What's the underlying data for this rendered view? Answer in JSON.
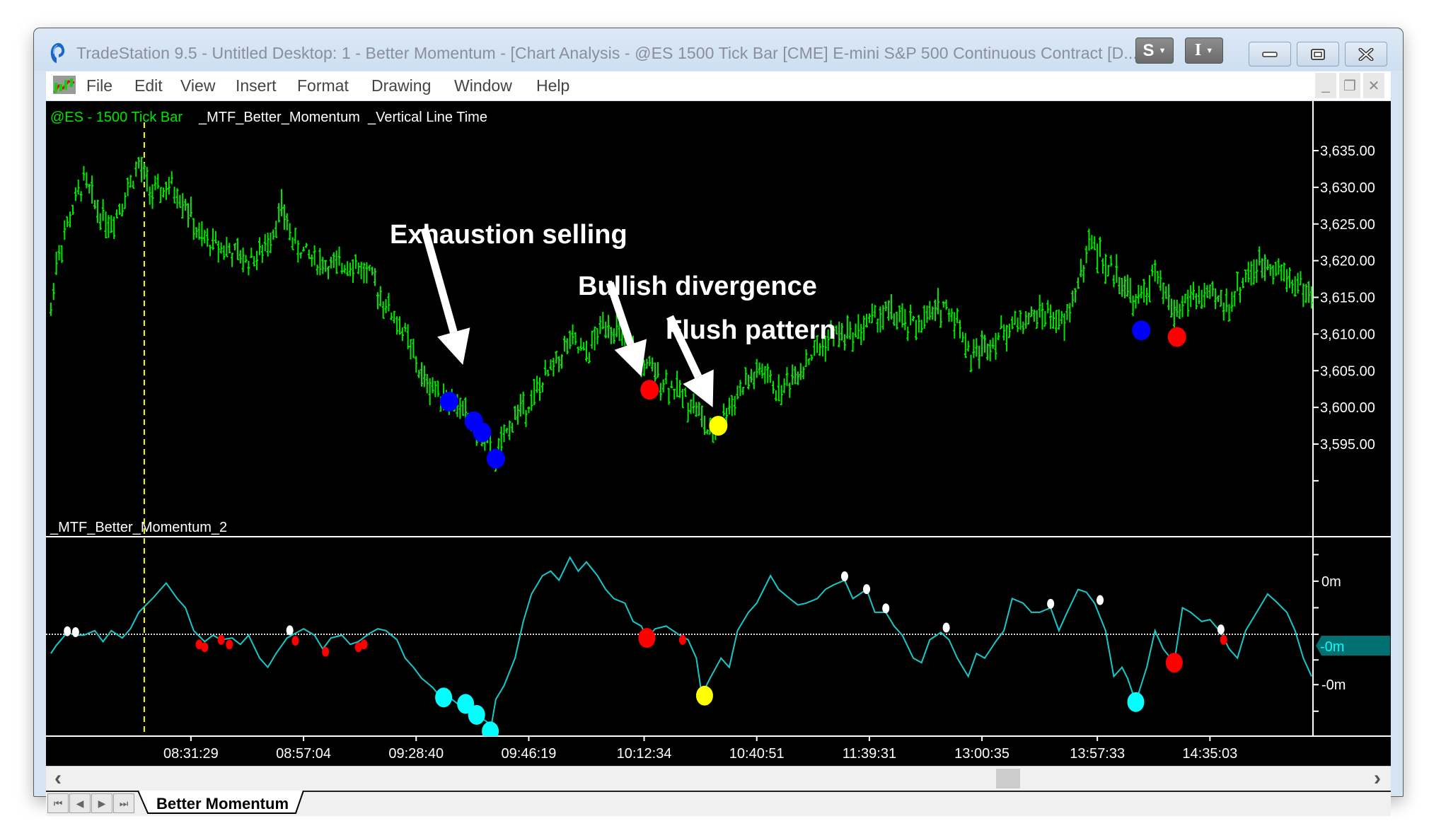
{
  "window": {
    "title": "TradeStation 9.5 - Untitled Desktop: 1 - Better Momentum - [Chart Analysis - @ES 1500 Tick Bar [CME] E-mini S&P 500 Continuous Contract [D...]]",
    "s_button": "S",
    "i_button": "I",
    "controls": {
      "minimize": "minimize",
      "restore": "restore",
      "close": "close"
    }
  },
  "menu": {
    "items": [
      "File",
      "Edit",
      "View",
      "Insert",
      "Format",
      "Drawing",
      "Window",
      "Help"
    ],
    "mdi": {
      "minimize": "_",
      "restore": "❐",
      "close": "✕"
    }
  },
  "chart_data": [
    {
      "type": "ohlc",
      "title_symbol": "@ES - 1500 Tick Bar",
      "title_studies": "_MTF_Better_Momentum  _Vertical Line Time",
      "ylabel": "",
      "ylim": [
        3590,
        3637.5
      ],
      "yticks": [
        "3,635.00",
        "3,630.00",
        "3,625.00",
        "3,620.00",
        "3,615.00",
        "3,610.00",
        "3,605.00",
        "3,600.00",
        "3,595.00"
      ],
      "ytick_values": [
        3635,
        3630,
        3625,
        3620,
        3615,
        3610,
        3605,
        3600,
        3595
      ],
      "bar_count": 461,
      "series_color": "#00e600",
      "price_path": [
        [
          1,
          3613
        ],
        [
          3,
          3620
        ],
        [
          8,
          3626
        ],
        [
          13,
          3631
        ],
        [
          18,
          3627
        ],
        [
          23,
          3625
        ],
        [
          28,
          3629
        ],
        [
          33,
          3633
        ],
        [
          38,
          3629
        ],
        [
          45,
          3630
        ],
        [
          50,
          3628
        ],
        [
          55,
          3623
        ],
        [
          63,
          3622
        ],
        [
          72,
          3620
        ],
        [
          78,
          3621
        ],
        [
          85,
          3627
        ],
        [
          90,
          3622
        ],
        [
          98,
          3620
        ],
        [
          105,
          3619
        ],
        [
          110,
          3620
        ],
        [
          117,
          3618
        ],
        [
          123,
          3614
        ],
        [
          130,
          3610
        ],
        [
          136,
          3604
        ],
        [
          143,
          3602
        ],
        [
          150,
          3600
        ],
        [
          156,
          3597
        ],
        [
          163,
          3593
        ],
        [
          170,
          3599
        ],
        [
          176,
          3601
        ],
        [
          183,
          3605
        ],
        [
          190,
          3609
        ],
        [
          196,
          3607
        ],
        [
          203,
          3612
        ],
        [
          210,
          3609
        ],
        [
          216,
          3606
        ],
        [
          223,
          3604
        ],
        [
          230,
          3602
        ],
        [
          236,
          3600
        ],
        [
          241,
          3596
        ],
        [
          246,
          3599
        ],
        [
          253,
          3603
        ],
        [
          260,
          3605
        ],
        [
          266,
          3602
        ],
        [
          273,
          3605
        ],
        [
          280,
          3608
        ],
        [
          286,
          3610
        ],
        [
          293,
          3610
        ],
        [
          300,
          3612
        ],
        [
          306,
          3613
        ],
        [
          313,
          3611
        ],
        [
          320,
          3612
        ],
        [
          326,
          3614
        ],
        [
          331,
          3612
        ],
        [
          336,
          3607
        ],
        [
          343,
          3609
        ],
        [
          350,
          3611
        ],
        [
          356,
          3612
        ],
        [
          363,
          3613
        ],
        [
          370,
          3611
        ],
        [
          375,
          3617
        ],
        [
          380,
          3623
        ],
        [
          385,
          3619
        ],
        [
          390,
          3618
        ],
        [
          396,
          3614
        ],
        [
          403,
          3618
        ],
        [
          410,
          3613
        ],
        [
          416,
          3615
        ],
        [
          423,
          3615
        ],
        [
          430,
          3614
        ],
        [
          436,
          3618
        ],
        [
          445,
          3620
        ],
        [
          450,
          3618
        ],
        [
          455,
          3617
        ],
        [
          460,
          3615
        ]
      ],
      "markers": [
        {
          "bar": 146,
          "price": 3600.8,
          "color": "#0000ff"
        },
        {
          "bar": 155,
          "price": 3598.1,
          "color": "#0000ff"
        },
        {
          "bar": 158,
          "price": 3596.6,
          "color": "#0000ff"
        },
        {
          "bar": 163,
          "price": 3593.0,
          "color": "#0000ff"
        },
        {
          "bar": 219,
          "price": 3602.4,
          "color": "#ff0000"
        },
        {
          "bar": 244,
          "price": 3597.5,
          "color": "#ffff00"
        },
        {
          "bar": 398,
          "price": 3610.5,
          "color": "#0000ff"
        },
        {
          "bar": 411,
          "price": 3609.6,
          "color": "#ff0000"
        }
      ],
      "vertical_line_bar": 35,
      "vertical_line_color": "#ffff00",
      "annotations": [
        {
          "text": "Exhaustion selling",
          "arrow_to_bar": 151,
          "arrow_to_price": 3605.8
        },
        {
          "text": "Bullish divergence",
          "arrow_to_bar": 216,
          "arrow_to_price": 3604.2
        },
        {
          "text": "Flush pattern",
          "arrow_to_bar": 242,
          "arrow_to_price": 3600.0
        }
      ]
    },
    {
      "type": "line",
      "title": "_MTF_Better_Momentum_2",
      "ylim": [
        -1.14,
        1.03
      ],
      "yticks": [
        "0m",
        "-0m"
      ],
      "ytick_values": [
        0.58,
        -0.55
      ],
      "last_value_label": "-0m",
      "last_value": 0.12,
      "zero_line": 0,
      "series_color": "#16c8c8",
      "values": [
        [
          1,
          -0.21
        ],
        [
          3,
          -0.12
        ],
        [
          7,
          0.02
        ],
        [
          10,
          -0.01
        ],
        [
          13,
          -0.01
        ],
        [
          17,
          0.04
        ],
        [
          20,
          -0.08
        ],
        [
          23,
          0.04
        ],
        [
          27,
          -0.04
        ],
        [
          30,
          0.06
        ],
        [
          33,
          0.24
        ],
        [
          38,
          0.39
        ],
        [
          43,
          0.56
        ],
        [
          47,
          0.39
        ],
        [
          50,
          0.29
        ],
        [
          53,
          0.04
        ],
        [
          57,
          -0.08
        ],
        [
          60,
          -0.01
        ],
        [
          63,
          -0.06
        ],
        [
          67,
          -0.04
        ],
        [
          70,
          -0.11
        ],
        [
          73,
          -0.01
        ],
        [
          77,
          -0.26
        ],
        [
          80,
          -0.36
        ],
        [
          83,
          -0.21
        ],
        [
          87,
          -0.04
        ],
        [
          90,
          0.01
        ],
        [
          93,
          0.06
        ],
        [
          97,
          -0.01
        ],
        [
          100,
          -0.16
        ],
        [
          103,
          -0.04
        ],
        [
          107,
          -0.01
        ],
        [
          110,
          -0.11
        ],
        [
          113,
          -0.08
        ],
        [
          117,
          0.01
        ],
        [
          120,
          0.06
        ],
        [
          123,
          0.04
        ],
        [
          127,
          -0.06
        ],
        [
          130,
          -0.26
        ],
        [
          133,
          -0.36
        ],
        [
          136,
          -0.48
        ],
        [
          140,
          -0.58
        ],
        [
          143,
          -0.69
        ],
        [
          147,
          -0.71
        ],
        [
          150,
          -0.78
        ],
        [
          153,
          -0.84
        ],
        [
          156,
          -0.88
        ],
        [
          160,
          -0.96
        ],
        [
          161,
          -1.06
        ],
        [
          163,
          -0.71
        ],
        [
          166,
          -0.56
        ],
        [
          170,
          -0.26
        ],
        [
          173,
          0.14
        ],
        [
          176,
          0.44
        ],
        [
          180,
          0.64
        ],
        [
          183,
          0.69
        ],
        [
          186,
          0.59
        ],
        [
          190,
          0.84
        ],
        [
          193,
          0.69
        ],
        [
          196,
          0.79
        ],
        [
          200,
          0.64
        ],
        [
          203,
          0.49
        ],
        [
          206,
          0.39
        ],
        [
          210,
          0.34
        ],
        [
          213,
          0.14
        ],
        [
          216,
          0.09
        ],
        [
          218,
          -0.04
        ],
        [
          221,
          0.06
        ],
        [
          225,
          0.09
        ],
        [
          230,
          -0.01
        ],
        [
          233,
          -0.06
        ],
        [
          236,
          -0.26
        ],
        [
          238,
          -0.66
        ],
        [
          241,
          -0.48
        ],
        [
          245,
          -0.26
        ],
        [
          248,
          -0.36
        ],
        [
          251,
          0.04
        ],
        [
          255,
          0.24
        ],
        [
          258,
          0.34
        ],
        [
          263,
          0.64
        ],
        [
          266,
          0.49
        ],
        [
          270,
          0.39
        ],
        [
          273,
          0.32
        ],
        [
          276,
          0.34
        ],
        [
          280,
          0.39
        ],
        [
          283,
          0.49
        ],
        [
          286,
          0.54
        ],
        [
          290,
          0.59
        ],
        [
          293,
          0.39
        ],
        [
          298,
          0.49
        ],
        [
          301,
          0.24
        ],
        [
          305,
          0.24
        ],
        [
          308,
          0.09
        ],
        [
          311,
          -0.01
        ],
        [
          315,
          -0.26
        ],
        [
          318,
          -0.31
        ],
        [
          321,
          -0.06
        ],
        [
          325,
          0.02
        ],
        [
          328,
          -0.06
        ],
        [
          331,
          -0.26
        ],
        [
          335,
          -0.46
        ],
        [
          338,
          -0.21
        ],
        [
          341,
          -0.26
        ],
        [
          345,
          -0.08
        ],
        [
          348,
          0.04
        ],
        [
          351,
          0.39
        ],
        [
          355,
          0.34
        ],
        [
          358,
          0.24
        ],
        [
          361,
          0.24
        ],
        [
          365,
          0.29
        ],
        [
          368,
          0.04
        ],
        [
          371,
          0.24
        ],
        [
          375,
          0.49
        ],
        [
          378,
          0.46
        ],
        [
          381,
          0.34
        ],
        [
          385,
          0.04
        ],
        [
          388,
          -0.46
        ],
        [
          391,
          -0.36
        ],
        [
          393,
          -0.48
        ],
        [
          396,
          -0.74
        ],
        [
          400,
          -0.36
        ],
        [
          403,
          0.04
        ],
        [
          406,
          -0.16
        ],
        [
          410,
          -0.31
        ],
        [
          413,
          0.29
        ],
        [
          416,
          0.24
        ],
        [
          420,
          0.14
        ],
        [
          423,
          0.16
        ],
        [
          427,
          0.02
        ],
        [
          430,
          -0.16
        ],
        [
          433,
          -0.26
        ],
        [
          436,
          0.04
        ],
        [
          440,
          0.24
        ],
        [
          444,
          0.44
        ],
        [
          447,
          0.36
        ],
        [
          451,
          0.24
        ],
        [
          454,
          0.04
        ],
        [
          457,
          -0.26
        ],
        [
          460,
          -0.46
        ]
      ],
      "markers": [
        {
          "bar": 7,
          "value": 0.01,
          "color": "#ffffff",
          "size": "small"
        },
        {
          "bar": 10,
          "value": 0.0,
          "color": "#ffffff",
          "size": "small"
        },
        {
          "bar": 88,
          "value": 0.02,
          "color": "#ffffff",
          "size": "small"
        },
        {
          "bar": 290,
          "value": 0.61,
          "color": "#ffffff",
          "size": "small"
        },
        {
          "bar": 298,
          "value": 0.47,
          "color": "#ffffff",
          "size": "small"
        },
        {
          "bar": 305,
          "value": 0.26,
          "color": "#ffffff",
          "size": "small"
        },
        {
          "bar": 327,
          "value": 0.05,
          "color": "#ffffff",
          "size": "small"
        },
        {
          "bar": 365,
          "value": 0.31,
          "color": "#ffffff",
          "size": "small"
        },
        {
          "bar": 383,
          "value": 0.35,
          "color": "#ffffff",
          "size": "small"
        },
        {
          "bar": 427,
          "value": 0.03,
          "color": "#ffffff",
          "size": "small"
        },
        {
          "bar": 55,
          "value": -0.08,
          "color": "#ff0000",
          "size": "small"
        },
        {
          "bar": 57,
          "value": -0.11,
          "color": "#ff0000",
          "size": "small"
        },
        {
          "bar": 63,
          "value": -0.03,
          "color": "#ff0000",
          "size": "small"
        },
        {
          "bar": 66,
          "value": -0.08,
          "color": "#ff0000",
          "size": "small"
        },
        {
          "bar": 90,
          "value": -0.04,
          "color": "#ff0000",
          "size": "small"
        },
        {
          "bar": 101,
          "value": -0.16,
          "color": "#ff0000",
          "size": "small"
        },
        {
          "bar": 113,
          "value": -0.11,
          "color": "#ff0000",
          "size": "small"
        },
        {
          "bar": 115,
          "value": -0.08,
          "color": "#ff0000",
          "size": "small"
        },
        {
          "bar": 231,
          "value": -0.03,
          "color": "#ff0000",
          "size": "small"
        },
        {
          "bar": 428,
          "value": -0.03,
          "color": "#ff0000",
          "size": "small"
        },
        {
          "bar": 218,
          "value": -0.04,
          "color": "#ff0000",
          "size": "large"
        },
        {
          "bar": 410,
          "value": -0.31,
          "color": "#ff0000",
          "size": "large"
        },
        {
          "bar": 144,
          "value": -0.69,
          "color": "#00ffff",
          "size": "large"
        },
        {
          "bar": 152,
          "value": -0.76,
          "color": "#00ffff",
          "size": "large"
        },
        {
          "bar": 156,
          "value": -0.88,
          "color": "#00ffff",
          "size": "large"
        },
        {
          "bar": 161,
          "value": -1.06,
          "color": "#00ffff",
          "size": "large"
        },
        {
          "bar": 239,
          "value": -0.67,
          "color": "#ffff00",
          "size": "large"
        },
        {
          "bar": 396,
          "value": -0.74,
          "color": "#00ffff",
          "size": "large"
        }
      ]
    }
  ],
  "time_axis": {
    "labels": [
      "08:31:29",
      "08:57:04",
      "09:28:40",
      "09:46:19",
      "10:12:34",
      "10:40:51",
      "11:39:31",
      "13:00:35",
      "13:57:33",
      "14:35:03"
    ],
    "label_bars": [
      52,
      93,
      134,
      175,
      217,
      258,
      299,
      340,
      382,
      423
    ]
  },
  "scrollbar": {
    "left_arrow": "‹",
    "right_arrow": "›",
    "thumb_position": 0.725
  },
  "tabs": {
    "nav": [
      "⏮",
      "◀",
      "▶",
      "⏭"
    ],
    "active_tab": "Better Momentum"
  }
}
